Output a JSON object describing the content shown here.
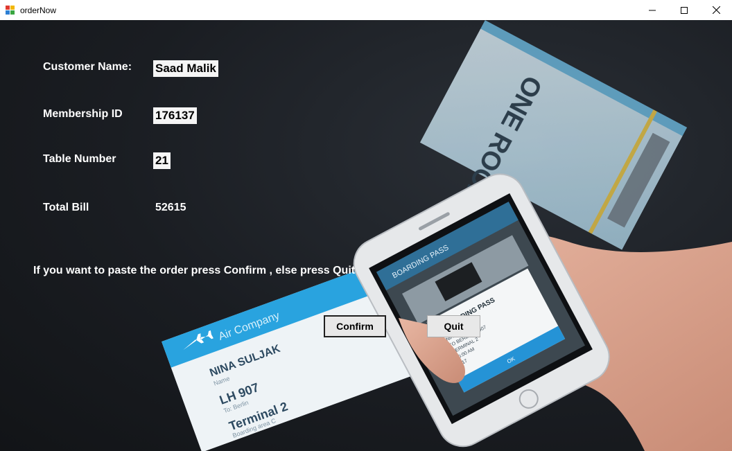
{
  "window": {
    "title": "orderNow",
    "controls": [
      "minimize-icon",
      "maximize-icon",
      "close-icon"
    ]
  },
  "form": {
    "customer_name": {
      "label": "Customer Name:",
      "value": "Saad Malik"
    },
    "membership_id": {
      "label": "Membership ID",
      "value": "176137"
    },
    "table_number": {
      "label": "Table Number",
      "value": "21"
    },
    "total_bill": {
      "label": "Total Bill",
      "value": "52615"
    }
  },
  "message": "If you want to paste the order press Confirm , else press Quit",
  "buttons": {
    "confirm": "Confirm",
    "quit": "Quit"
  },
  "background": {
    "ticket_front": {
      "company": "Air Company",
      "name": "NINA SULJAK",
      "name_caption": "Name",
      "flight": "LH 907",
      "flight_caption": "To: Berlin",
      "terminal": "Terminal 2",
      "terminal_caption": "Boarding area C"
    },
    "ticket_back_text": "ONE ROCK BAND",
    "phone": {
      "header": "BOARDING PASS",
      "card_title": "BOARDING PASS",
      "lines": [
        "NINA SULJAK",
        "TO BERLIN LH907",
        "TERMINAL 2",
        "15:00 AM",
        "A17"
      ],
      "ok": "OK"
    }
  },
  "colors": {
    "titlebar": "#ffffff",
    "background": "#1a1d22",
    "label": "#ffffff",
    "button": "#e8e8e8",
    "ticket_accent": "#29a3df"
  }
}
